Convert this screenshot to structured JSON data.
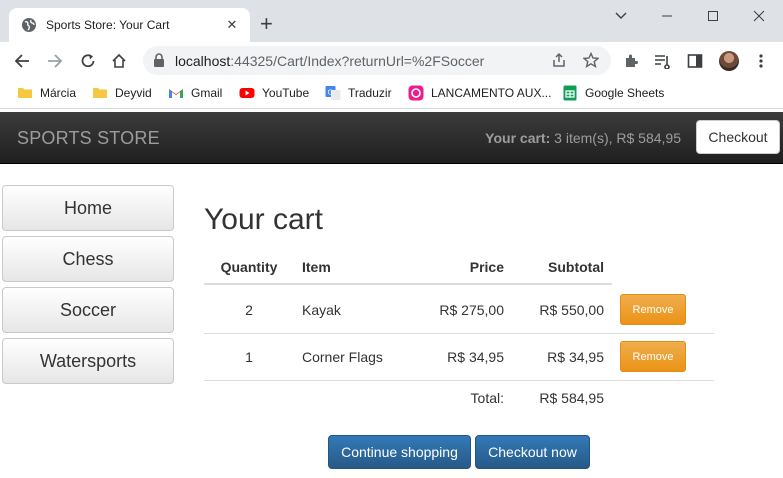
{
  "browser": {
    "tab_title": "Sports Store: Your Cart",
    "new_tab": "+",
    "url_host": "localhost",
    "url_rest": ":44325/Cart/Index?returnUrl=%2FSoccer",
    "bookmarks": [
      {
        "label": "Márcia",
        "icon": "folder-icon",
        "color": "#f5c842"
      },
      {
        "label": "Deyvid",
        "icon": "folder-icon",
        "color": "#f5c842"
      },
      {
        "label": "Gmail",
        "icon": "gmail-icon",
        "color": "#ea4335"
      },
      {
        "label": "YouTube",
        "icon": "youtube-icon",
        "color": "#ff0000"
      },
      {
        "label": "Traduzir",
        "icon": "translate-icon",
        "color": "#4285f4"
      },
      {
        "label": "LANCAMENTO AUX...",
        "icon": "app-icon",
        "color": "#e91e8c"
      },
      {
        "label": "Google Sheets",
        "icon": "sheets-icon",
        "color": "#0f9d58"
      }
    ]
  },
  "site": {
    "brand": "SPORTS STORE",
    "cart_label": "Your cart:",
    "cart_summary": "3 item(s), R$ 584,95",
    "checkout_button": "Checkout",
    "categories": [
      "Home",
      "Chess",
      "Soccer",
      "Watersports"
    ],
    "heading": "Your cart",
    "table": {
      "headers": {
        "quantity": "Quantity",
        "item": "Item",
        "price": "Price",
        "subtotal": "Subtotal"
      },
      "rows": [
        {
          "quantity": "2",
          "item": "Kayak",
          "price": "R$ 275,00",
          "subtotal": "R$ 550,00",
          "action": "Remove"
        },
        {
          "quantity": "1",
          "item": "Corner Flags",
          "price": "R$ 34,95",
          "subtotal": "R$ 34,95",
          "action": "Remove"
        }
      ],
      "total_label": "Total:",
      "total_value": "R$ 584,95"
    },
    "continue_button": "Continue shopping",
    "checkout_now_button": "Checkout now",
    "colors": {
      "navbar": "#222222",
      "remove": "#f0ad4e",
      "primary": "#337ab7"
    }
  }
}
